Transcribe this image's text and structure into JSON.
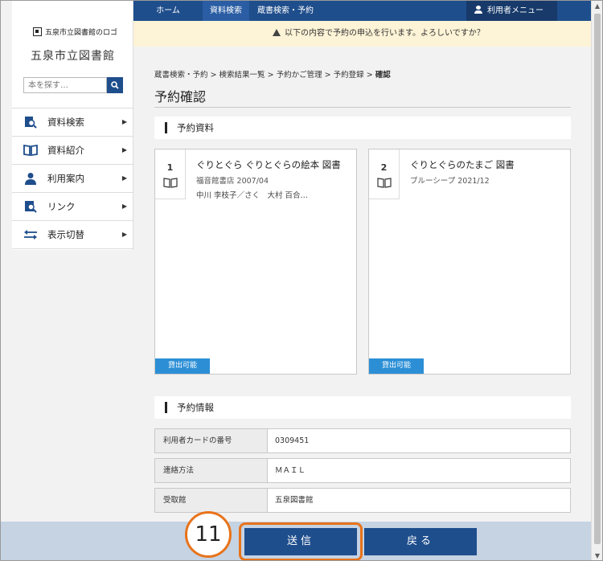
{
  "topnav": {
    "crumbs": [
      "ホーム",
      "資料検索",
      "蔵書検索・予約"
    ],
    "user_menu": "利用者メニュー"
  },
  "sidebar": {
    "logo_text": "五泉市立図書館のロゴ",
    "library_name": "五泉市立図書館",
    "search_placeholder": "本を探す…",
    "items": [
      {
        "label": "資料検索",
        "icon": "search-book-icon"
      },
      {
        "label": "資料紹介",
        "icon": "open-book-icon"
      },
      {
        "label": "利用案内",
        "icon": "person-icon"
      },
      {
        "label": "リンク",
        "icon": "link-icon"
      },
      {
        "label": "表示切替",
        "icon": "swap-arrows-icon"
      }
    ]
  },
  "alert": {
    "message": "以下の内容で予約の申込を行います。よろしいですか？"
  },
  "breadcrumb": {
    "items": [
      "蔵書検索・予約",
      "検索結果一覧",
      "予約かご管理",
      "予約登録",
      "確認"
    ],
    "separator": ">"
  },
  "page_title": "予約確認",
  "materials_section": {
    "heading": "予約資料",
    "cards": [
      {
        "number": "1",
        "title": "ぐりとぐら ぐりとぐらの絵本 図書",
        "publisher_date": "福音館書店 2007/04",
        "author": "中川 李枝子／さく　大村 百合…",
        "status": "貸出可能"
      },
      {
        "number": "2",
        "title": "ぐりとぐらのたまご 図書",
        "publisher_date": "ブルーシープ 2021/12",
        "author": "",
        "status": "貸出可能"
      }
    ]
  },
  "info_section": {
    "heading": "予約情報",
    "rows": [
      {
        "label": "利用者カードの番号",
        "value": "0309451"
      },
      {
        "label": "連絡方法",
        "value": "ＭＡＩＬ"
      },
      {
        "label": "受取館",
        "value": "五泉図書館"
      }
    ]
  },
  "actions": {
    "send_label": "送信",
    "back_label": "戻る",
    "step_number": "11"
  },
  "colors": {
    "nav_blue": "#1f4e8c",
    "badge_blue": "#2c8fd6",
    "alert_bg": "#fdf3d6",
    "highlight_orange": "#e8731a"
  }
}
